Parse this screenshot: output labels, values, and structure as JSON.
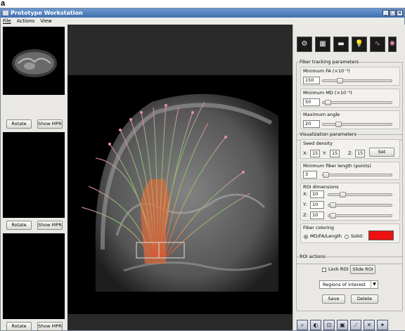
{
  "figure_label": "a",
  "window": {
    "title": "Prototype Workstation",
    "buttons": [
      "_",
      "□",
      "×"
    ]
  },
  "menu": [
    "File",
    "Actions",
    "View"
  ],
  "left_pane": {
    "thumbnails": [
      {
        "rotate_label": "Rotate",
        "mpr_label": "Show MPR"
      },
      {
        "rotate_label": "Rotate",
        "mpr_label": "Show MPR"
      },
      {
        "rotate_label": "Rotate",
        "mpr_label": "Show MPR"
      }
    ]
  },
  "toolbar_icons": [
    "settings-gears-icon",
    "film-icon",
    "slab-icon",
    "lightbulb-icon",
    "fibers-icon",
    "brain-icon"
  ],
  "fiber_tracking": {
    "title": "Fiber tracking parameters",
    "min_fa": {
      "label": "Minimum FA (×10⁻³)",
      "value": "150",
      "slider": 0.22
    },
    "min_md": {
      "label": "Minimum MD (×10⁻⁵)",
      "value": "50",
      "slider": 0.03
    },
    "max_angle": {
      "label": "Maximum angle",
      "value": "20",
      "slider": 0.2
    }
  },
  "visualization": {
    "title": "Visualization parameters",
    "seed_density": {
      "label": "Seed density",
      "x_label": "X:",
      "x": "15",
      "y_label": "Y:",
      "y": "15",
      "z_label": "Z:",
      "z": "15",
      "set_label": "Set"
    },
    "min_length": {
      "label": "Minimum fiber length (points)",
      "value": "3",
      "slider": 0.0
    },
    "roi_dimensions": {
      "label": "ROI dimensions",
      "x_label": "X:",
      "x": "10",
      "x_slider": 0.2,
      "y_label": "Y:",
      "y": "10",
      "y_slider": 0.02,
      "z_label": "Z:",
      "z": "10",
      "z_slider": 0.02
    },
    "fiber_coloring": {
      "label": "Fiber coloring",
      "option1": "MD/FA/Length",
      "option2": "Solid:",
      "selected": "MD/FA/Length",
      "solid_color": "#ee1111"
    }
  },
  "roi_actions": {
    "title": "ROI actions",
    "lock_label": "Lock ROI",
    "slide_label": "Slide ROI",
    "dropdown_value": "Regions of interest",
    "save_label": "Save",
    "delete_label": "Delete"
  },
  "bottom_tools": [
    "zoom-icon",
    "rotate-icon",
    "view-icon",
    "roi-icon",
    "measure-icon",
    "select-icon",
    "pin-icon"
  ]
}
